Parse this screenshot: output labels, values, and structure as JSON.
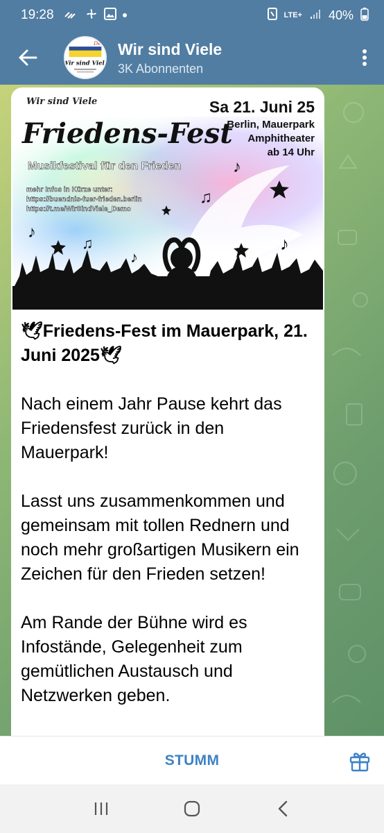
{
  "status": {
    "time": "19:28",
    "network": "LTE+",
    "battery": "40%"
  },
  "header": {
    "title": "Wir sind Viele",
    "subscribers": "3K Abonnenten",
    "avatar_text": "Wir sind Viele",
    "avatar_small": "Demo"
  },
  "poster": {
    "brand": "Wir sind Viele",
    "title": "Friedens-Fest",
    "subtitle": "Musikfestival für den Frieden",
    "date": "Sa 21. Juni 25",
    "location_line1": "Berlin, Mauerpark",
    "location_line2": "Amphitheater",
    "time": "ab 14 Uhr",
    "info_label": "mehr Infos in Kürze unter:",
    "link1": "https://buendnis-fuer-frieden.berlin",
    "link2": "https://t.me/WirSindViele_Demo"
  },
  "message": {
    "headline": "🕊Friedens-Fest im Mauerpark, 21. Juni 2025🕊",
    "paragraphs": [
      "Nach einem Jahr Pause kehrt das Friedensfest zurück in den Mauerpark!",
      "Lasst uns zusammenkommen und gemeinsam mit tollen Rednern und noch mehr großartigen Musikern ein Zeichen für den Frieden setzen!",
      "Am Rande der Bühne wird es Infostände, Gelegenheit zum gemütlichen Austausch und Netzwerken geben."
    ]
  },
  "bottom": {
    "mute_label": "STUMM"
  },
  "colors": {
    "header": "#517da2",
    "accent": "#3e82c4"
  }
}
